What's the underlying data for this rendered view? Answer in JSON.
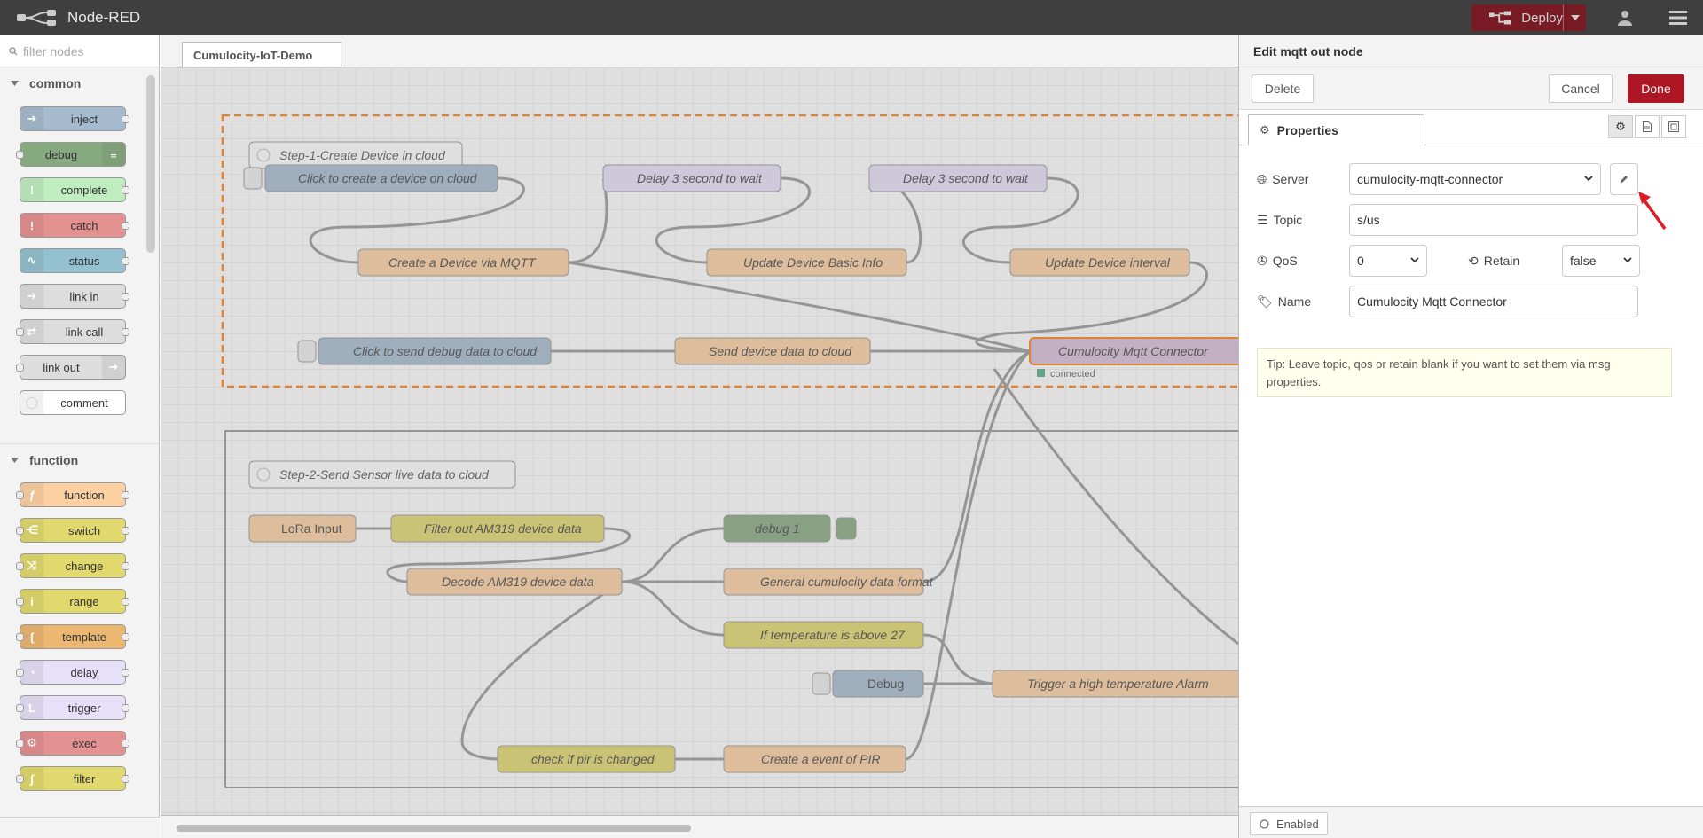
{
  "header": {
    "title": "Node-RED",
    "deploy_label": "Deploy"
  },
  "palette": {
    "filter_placeholder": "filter nodes",
    "categories": [
      {
        "label": "common",
        "nodes": [
          "inject",
          "debug",
          "complete",
          "catch",
          "status",
          "link in",
          "link call",
          "link out",
          "comment"
        ]
      },
      {
        "label": "function",
        "nodes": [
          "function",
          "switch",
          "change",
          "range",
          "template",
          "delay",
          "trigger",
          "exec",
          "filter"
        ]
      }
    ]
  },
  "workspace": {
    "tab": "Cumulocity-IoT-Demo",
    "comments": [
      "Step-1-Create Device in cloud",
      "Step-2-Send Sensor live data to cloud"
    ],
    "nodes": [
      "Click to create a device on cloud",
      "Create a Device via MQTT",
      "Delay 3 second to wait",
      "Update Device Basic Info",
      "Delay 3 second to wait",
      "Update Device interval",
      "Click to send debug data to cloud",
      "Send device data to cloud",
      "Cumulocity Mqtt Connector",
      "LoRa Input",
      "Filter out AM319 device data",
      "Decode AM319 device data",
      "debug 1",
      "General cumulocity data format",
      "If temperature is above 27",
      "Debug",
      "Trigger a high temperature Alarm",
      "check if pir is changed",
      "Create a event of PIR"
    ],
    "status": "connected"
  },
  "tray": {
    "title": "Edit mqtt out node",
    "delete": "Delete",
    "cancel": "Cancel",
    "done": "Done",
    "tab": "Properties",
    "server_label": "Server",
    "server_value": "cumulocity-mqtt-connector",
    "topic_label": "Topic",
    "topic_value": "s/us",
    "qos_label": "QoS",
    "qos_value": "0",
    "retain_label": "Retain",
    "retain_value": "false",
    "name_label": "Name",
    "name_value": "Cumulocity Mqtt Connector",
    "tip": "Tip: Leave topic, qos or retain blank if you want to set them via msg properties.",
    "enabled": "Enabled"
  },
  "colors": {
    "header": "#3f3f3f",
    "accent": "#ad1625",
    "function": "#fdd0a2",
    "inject": "#a6bbcf",
    "debug": "#87a980",
    "delay": "#e6e0f8",
    "switch": "#e2d96e",
    "catch": "#e49191"
  }
}
